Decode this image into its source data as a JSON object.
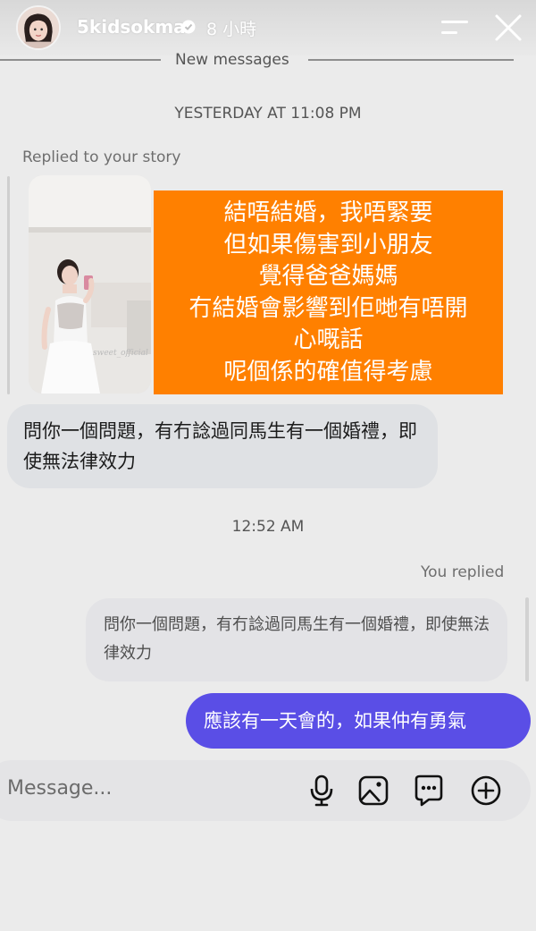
{
  "header": {
    "username": "5kidsokma",
    "time_ago": "8 小時",
    "avatar_icon": "avatar",
    "verified_icon": "verified-badge-icon",
    "menu_icon": "menu-icon",
    "close_icon": "close-icon"
  },
  "thread": {
    "new_messages_label": "New messages",
    "timestamp_1": "YESTERDAY AT 11:08 PM",
    "story_reply_label": "Replied to your story",
    "story_text_lines": [
      "結唔結婚，我唔緊要",
      "但如果傷害到小朋友",
      "覺得爸爸媽媽",
      "冇結婚會影響到佢哋有唔開",
      "心嘅話",
      "呢個係的確值得考慮"
    ],
    "story_watermark": "sweet_official",
    "incoming_message": "問你一個問題，有冇諗過同馬生有一個婚禮，即使無法律效力",
    "timestamp_2": "12:52 AM",
    "you_replied_label": "You replied",
    "quoted_message": "問你一個問題，有冇諗過同馬生有一個婚禮，即使無法律效力",
    "outgoing_message": "應該有一天會的，如果仲有勇氣"
  },
  "composer": {
    "placeholder": "Message...",
    "icons": [
      "microphone-icon",
      "gallery-icon",
      "sticker-chat-icon",
      "plus-icon"
    ]
  },
  "colors": {
    "outgoing_bubble": "#5a4ee6",
    "story_overlay": "#ff8000",
    "incoming_bubble": "#dfe1e4"
  }
}
